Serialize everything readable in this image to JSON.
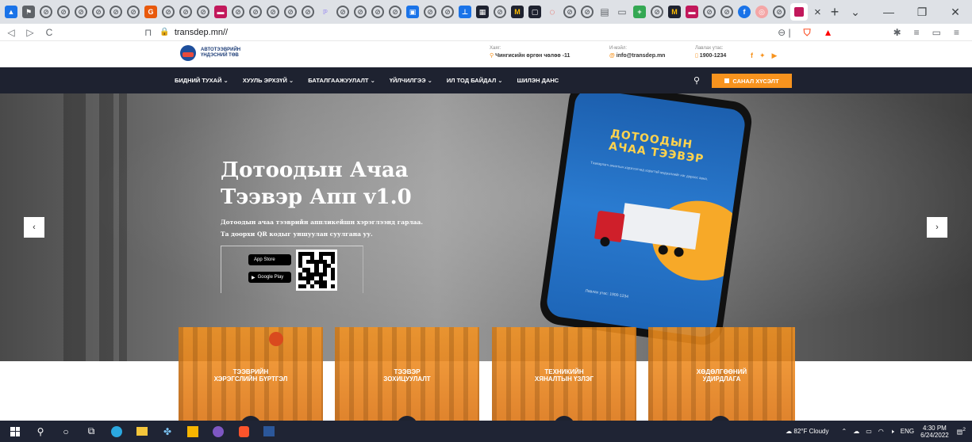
{
  "browser": {
    "tab_favicon_colors": [
      "#4285f4",
      "#5f6368",
      "#5f6368",
      "#5f6368",
      "#5f6368",
      "#5f6368",
      "#5f6368",
      "#ea4335",
      "#5f6368",
      "#5f6368",
      "#5f6368",
      "#ea4335",
      "#5f6368",
      "#5f6368",
      "#5f6368",
      "#5f6368",
      "#5f6368",
      "#5f6368",
      "#5f6368",
      "#5f6368",
      "#5f6368",
      "#5f6368",
      "#fbbc04",
      "#5f6368",
      "#5f6368",
      "#4285f4",
      "#1e2230",
      "#5f6368",
      "#fbbc04",
      "#1e2230",
      "#ea4335",
      "#5f6368",
      "#5f6368",
      "#5f6368",
      "#34a853",
      "#5f6368",
      "#fbbc04",
      "#5f6368",
      "#ea4335",
      "#5f6368",
      "#5f6368",
      "#4285f4",
      "#ea4335",
      "#5f6368",
      "#ea4335"
    ],
    "url": "transdep.mn//",
    "new_tab_glyph": "+",
    "close_tab_glyph": "×"
  },
  "site": {
    "logo": {
      "line1": "АВТОТЭЭВРИЙН",
      "line2": "ҮНДЭСНИЙ ТӨВ"
    },
    "contacts": [
      {
        "label": "Хаяг:",
        "value": "Чингисийн өргөн чөлөө -11",
        "icon": "location-icon"
      },
      {
        "label": "И-мэйл:",
        "value": "info@transdep.mn",
        "icon": "email-icon"
      },
      {
        "label": "Лавлах утас:",
        "value": "1900-1234",
        "icon": "phone-icon"
      }
    ],
    "social": {
      "facebook": "f",
      "twitter": "🐦",
      "youtube": "▶"
    },
    "nav": [
      {
        "label": "БИДНИЙ ТУХАЙ ⌄"
      },
      {
        "label": "ХУУЛЬ ЭРХЗҮЙ ⌄"
      },
      {
        "label": "БАТАЛГААЖУУЛАЛТ ⌄"
      },
      {
        "label": "ҮЙЛЧИЛГЭЭ ⌄"
      },
      {
        "label": "ИЛ ТОД БАЙДАЛ ⌄"
      },
      {
        "label": "ШИЛЭН ДАНС"
      }
    ],
    "cta": "САНАЛ ХҮСЭЛТ",
    "accent": "#f7931e",
    "nav_bg": "#1e2230"
  },
  "hero": {
    "title": "Дотоодын Ачаа Тээвэр Апп v1.0",
    "subtitle_line1": "Дотоодын ачаа тээврийн аппликейшн хэрэглээнд гарлаа.",
    "subtitle_line2": "Та доорхи QR кодыг уншуулан суулгана уу.",
    "app_store": "App Store",
    "google_play": "Google Play",
    "phone_screen": {
      "title_line1": "ДОТООДЫН",
      "title_line2": "АЧАА ТЭЭВЭР",
      "desc": "Тээвэрлэгч ачилтын хэрэглэгчид хэрэгтэй мэдээллийг нэг дороос авна.",
      "hotline": "Лавлах утас: 1900-1234"
    },
    "prev": "‹",
    "next": "›"
  },
  "services": [
    {
      "line1": "ТЭЭВРИЙН",
      "line2": "ХЭРЭГСЛИЙН БҮРТГЭЛ"
    },
    {
      "line1": "ТЭЭВЭР",
      "line2": "ЗОХИЦУУЛАЛТ"
    },
    {
      "line1": "ТЕХНИКИЙН",
      "line2": "ХЯНАЛТЫН ҮЗЛЭГ"
    },
    {
      "line1": "ХӨДӨЛГӨӨНИЙ",
      "line2": "УДИРДЛАГА"
    }
  ],
  "taskbar": {
    "weather": "82°F  Cloudy",
    "lang": "ENG",
    "time": "4:30 PM",
    "date": "6/24/2022",
    "notifications": "2"
  }
}
